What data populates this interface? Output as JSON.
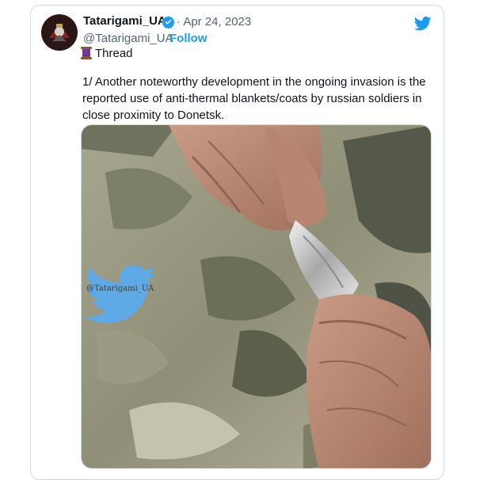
{
  "tweet": {
    "display_name": "Tatarigami_UA",
    "verified_icon": "verified-badge-icon",
    "date": "· Apr 24, 2023",
    "handle": "@Tatarigami_UA",
    "separator": "·",
    "follow_label": "Follow",
    "platform_icon": "twitter-bird-icon",
    "thread_icon": "spool-of-thread-icon",
    "thread_label": "Thread",
    "text": "1/ Another noteworthy development in the ongoing invasion is the reported use of anti-thermal blankets/coats by russian soldiers in close proximity to Donetsk.",
    "media": {
      "watermark_icon": "twitter-bird-icon",
      "watermark_text": "@Tatarigami_UA"
    }
  },
  "colors": {
    "accent": "#1d9bf0",
    "secondary_text": "#536471",
    "border": "#cfd9de",
    "primary_text": "#0f1419"
  }
}
